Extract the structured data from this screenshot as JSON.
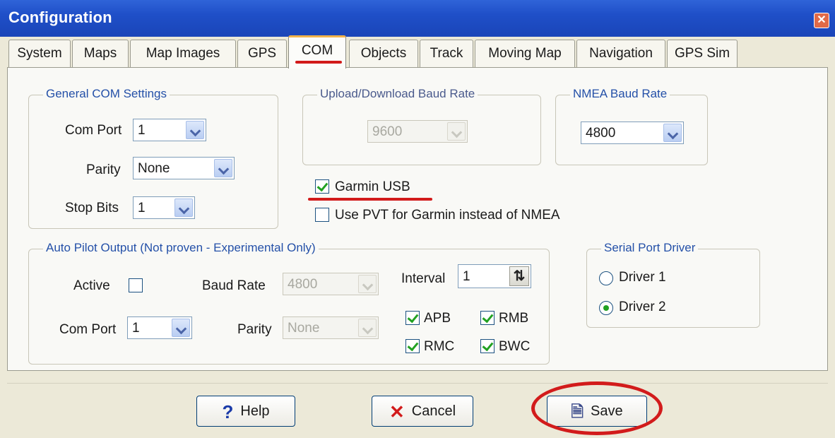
{
  "window": {
    "title": "Configuration"
  },
  "tabs": [
    "System",
    "Maps",
    "Map Images",
    "GPS",
    "COM",
    "Objects",
    "Track",
    "Moving Map",
    "Navigation",
    "GPS Sim"
  ],
  "general_com": {
    "legend": "General COM Settings",
    "com_port_label": "Com Port",
    "com_port_value": "1",
    "parity_label": "Parity",
    "parity_value": "None",
    "stop_bits_label": "Stop Bits",
    "stop_bits_value": "1"
  },
  "upload_baud": {
    "legend": "Upload/Download Baud Rate",
    "value": "9600"
  },
  "nmea_baud": {
    "legend": "NMEA Baud Rate",
    "value": "4800"
  },
  "garmin_usb": {
    "label": "Garmin USB",
    "checked": true
  },
  "use_pvt": {
    "label": "Use PVT for Garmin instead of NMEA",
    "checked": false
  },
  "autopilot": {
    "legend": "Auto Pilot Output  (Not proven - Experimental Only)",
    "active_label": "Active",
    "com_port_label": "Com Port",
    "com_port_value": "1",
    "baud_label": "Baud Rate",
    "baud_value": "4800",
    "parity_label": "Parity",
    "parity_value": "None",
    "interval_label": "Interval",
    "interval_value": "1",
    "sentences": {
      "apb": "APB",
      "rmb": "RMB",
      "rmc": "RMC",
      "bwc": "BWC"
    }
  },
  "serial_driver": {
    "legend": "Serial Port Driver",
    "driver1": "Driver 1",
    "driver2": "Driver 2",
    "selected": "Driver 2"
  },
  "buttons": {
    "help": "Help",
    "cancel": "Cancel",
    "save": "Save"
  },
  "icons": {
    "help": "question-mark",
    "cancel": "red-x",
    "save": "document-check",
    "close": "x"
  },
  "colors": {
    "titlebar": "#2456cc",
    "annotation": "#d21b1b",
    "check": "#21a121",
    "group_label": "#2450a8"
  }
}
